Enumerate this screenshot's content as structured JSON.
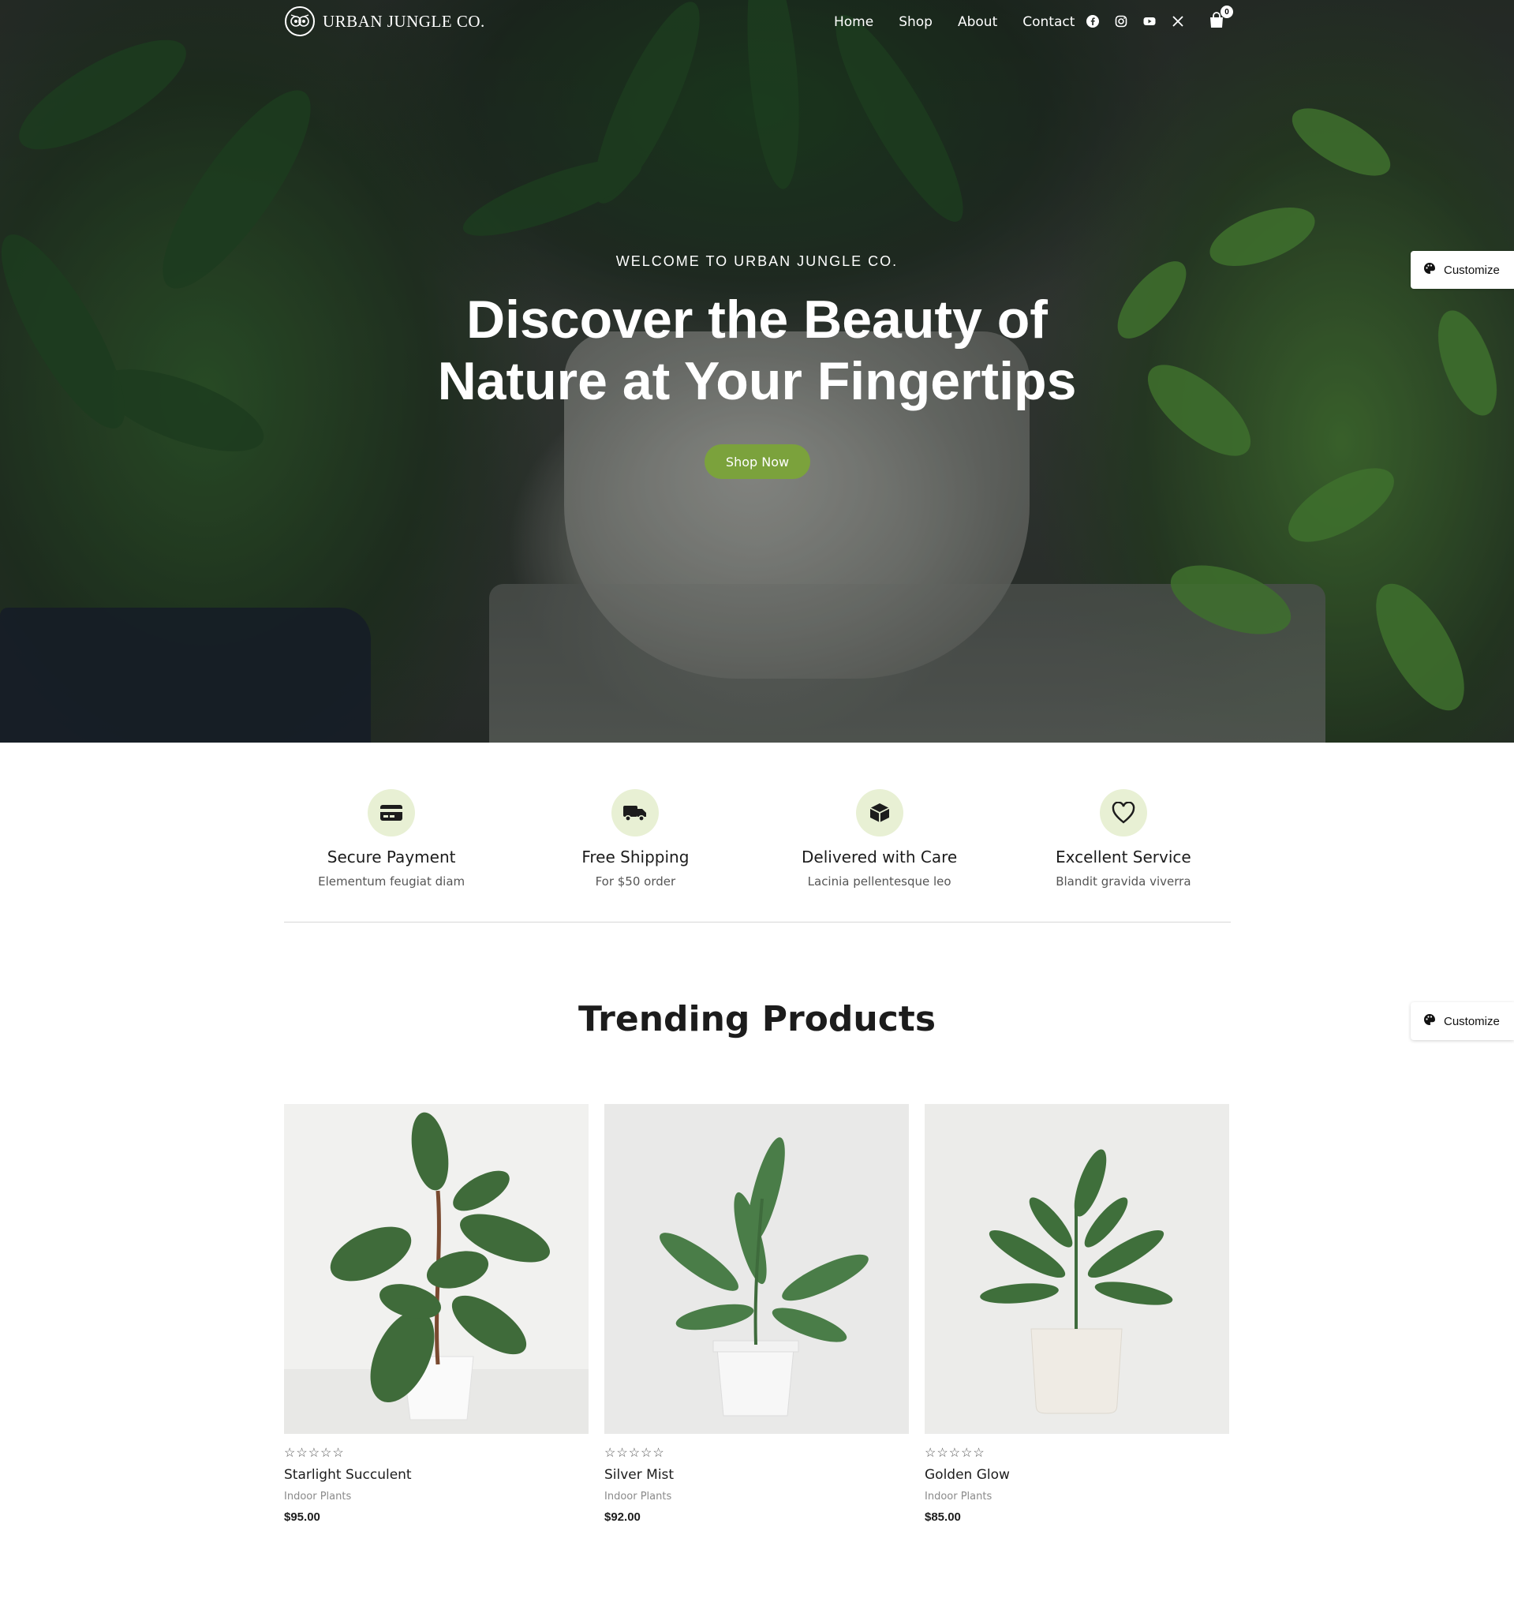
{
  "brand": {
    "name": "URBAN JUNGLE CO.",
    "logo_icon": "owl-icon"
  },
  "nav": {
    "items": [
      {
        "label": "Home"
      },
      {
        "label": "Shop"
      },
      {
        "label": "About"
      },
      {
        "label": "Contact"
      }
    ],
    "socials": [
      "facebook-icon",
      "instagram-icon",
      "youtube-icon",
      "x-icon"
    ],
    "cart": {
      "icon": "shopping-bag-icon",
      "count": "0"
    }
  },
  "hero": {
    "eyebrow": "WELCOME TO URBAN JUNGLE CO.",
    "title_line1": "Discover the Beauty of",
    "title_line2": "Nature at Your Fingertips",
    "cta_label": "Shop Now",
    "cta_color": "#7ba23c"
  },
  "customize": {
    "label": "Customize",
    "icon": "palette-icon"
  },
  "features": [
    {
      "icon": "credit-card-icon",
      "title": "Secure Payment",
      "subtitle": "Elementum feugiat diam"
    },
    {
      "icon": "truck-icon",
      "title": "Free Shipping",
      "subtitle": "For $50 order"
    },
    {
      "icon": "box-icon",
      "title": "Delivered with Care",
      "subtitle": "Lacinia pellentesque leo"
    },
    {
      "icon": "heart-icon",
      "title": "Excellent Service",
      "subtitle": "Blandit gravida viverra"
    }
  ],
  "feature_icon_bg": "#e8f0d4",
  "trending": {
    "title": "Trending Products",
    "products": [
      {
        "name": "Starlight Succulent",
        "category": "Indoor Plants",
        "price": "$95.00",
        "stars": "☆☆☆☆☆"
      },
      {
        "name": "Silver Mist",
        "category": "Indoor Plants",
        "price": "$92.00",
        "stars": "☆☆☆☆☆"
      },
      {
        "name": "Golden Glow",
        "category": "Indoor Plants",
        "price": "$85.00",
        "stars": "☆☆☆☆☆"
      }
    ]
  }
}
